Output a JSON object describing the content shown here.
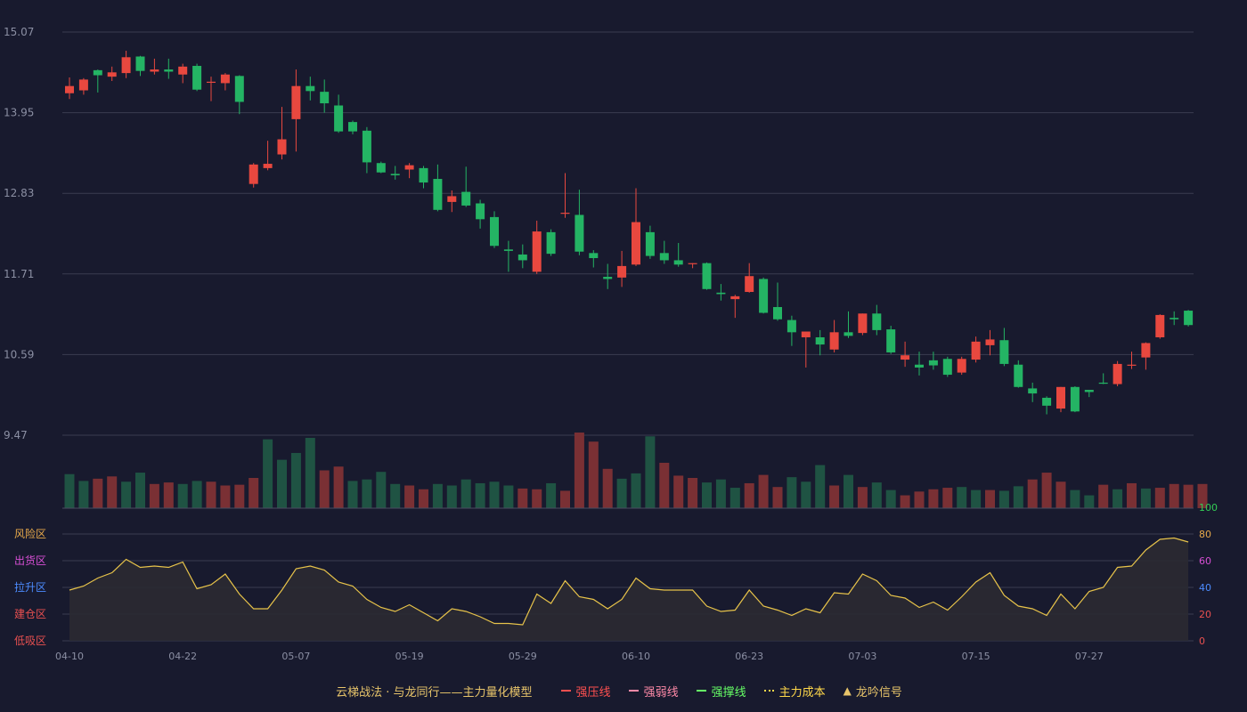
{
  "chart_data": {
    "type": "candlestick",
    "x_tick_labels": [
      "04-10",
      "04-22",
      "05-07",
      "05-19",
      "05-29",
      "06-10",
      "06-23",
      "07-03",
      "07-15",
      "07-27"
    ],
    "x_tick_index": [
      0,
      8,
      16,
      24,
      32,
      40,
      48,
      56,
      64,
      72
    ],
    "price_axis": {
      "ticks": [
        15.07,
        13.95,
        12.83,
        11.71,
        10.59,
        9.47
      ],
      "range": [
        9.47,
        15.07
      ]
    },
    "candles": [
      [
        14.22,
        14.32,
        14.14,
        14.44
      ],
      [
        14.26,
        14.41,
        14.2,
        14.43
      ],
      [
        14.54,
        14.47,
        14.23,
        14.55
      ],
      [
        14.45,
        14.51,
        14.39,
        14.59
      ],
      [
        14.5,
        14.72,
        14.43,
        14.81
      ],
      [
        14.73,
        14.53,
        14.46,
        14.74
      ],
      [
        14.52,
        14.55,
        14.48,
        14.7
      ],
      [
        14.55,
        14.52,
        14.42,
        14.7
      ],
      [
        14.48,
        14.59,
        14.36,
        14.63
      ],
      [
        14.6,
        14.27,
        14.25,
        14.63
      ],
      [
        14.37,
        14.38,
        14.11,
        14.45
      ],
      [
        14.36,
        14.48,
        14.26,
        14.5
      ],
      [
        14.46,
        14.1,
        13.93,
        14.47
      ],
      [
        12.96,
        13.23,
        12.91,
        13.25
      ],
      [
        13.18,
        13.24,
        13.15,
        13.56
      ],
      [
        13.37,
        13.58,
        13.3,
        14.03
      ],
      [
        13.86,
        14.32,
        13.41,
        14.55
      ],
      [
        14.32,
        14.25,
        14.12,
        14.45
      ],
      [
        14.24,
        14.08,
        13.95,
        14.41
      ],
      [
        14.05,
        13.69,
        13.67,
        14.2
      ],
      [
        13.82,
        13.69,
        13.65,
        13.84
      ],
      [
        13.7,
        13.26,
        13.11,
        13.75
      ],
      [
        13.25,
        13.12,
        13.11,
        13.27
      ],
      [
        13.1,
        13.08,
        13.02,
        13.21
      ],
      [
        13.16,
        13.22,
        13.04,
        13.25
      ],
      [
        13.18,
        12.98,
        12.9,
        13.21
      ],
      [
        13.03,
        12.6,
        12.58,
        13.23
      ],
      [
        12.71,
        12.79,
        12.57,
        12.87
      ],
      [
        12.85,
        12.66,
        12.64,
        13.2
      ],
      [
        12.69,
        12.47,
        12.34,
        12.74
      ],
      [
        12.5,
        12.1,
        12.07,
        12.58
      ],
      [
        12.05,
        12.03,
        11.74,
        12.17
      ],
      [
        11.98,
        11.9,
        11.79,
        12.12
      ],
      [
        11.74,
        12.3,
        11.71,
        12.45
      ],
      [
        12.29,
        11.99,
        11.96,
        12.33
      ],
      [
        12.55,
        12.56,
        12.49,
        13.11
      ],
      [
        12.53,
        12.02,
        11.97,
        12.88
      ],
      [
        12.0,
        11.93,
        11.8,
        12.04
      ],
      [
        11.67,
        11.64,
        11.5,
        11.85
      ],
      [
        11.66,
        11.82,
        11.53,
        12.03
      ],
      [
        11.84,
        12.43,
        11.82,
        12.9
      ],
      [
        12.29,
        11.96,
        11.92,
        12.38
      ],
      [
        12.0,
        11.9,
        11.85,
        12.17
      ],
      [
        11.9,
        11.84,
        11.81,
        12.14
      ],
      [
        11.86,
        11.86,
        11.79,
        11.86
      ],
      [
        11.86,
        11.5,
        11.49,
        11.87
      ],
      [
        11.45,
        11.43,
        11.34,
        11.57
      ],
      [
        11.36,
        11.4,
        11.1,
        11.42
      ],
      [
        11.46,
        11.68,
        11.45,
        11.86
      ],
      [
        11.64,
        11.17,
        11.16,
        11.66
      ],
      [
        11.25,
        11.08,
        11.06,
        11.59
      ],
      [
        11.07,
        10.9,
        10.71,
        11.13
      ],
      [
        10.83,
        10.91,
        10.41,
        10.91
      ],
      [
        10.83,
        10.73,
        10.58,
        10.93
      ],
      [
        10.66,
        10.9,
        10.62,
        11.07
      ],
      [
        10.9,
        10.85,
        10.82,
        11.19
      ],
      [
        10.89,
        11.16,
        10.86,
        11.16
      ],
      [
        11.16,
        10.93,
        10.86,
        11.28
      ],
      [
        10.94,
        10.62,
        10.6,
        10.99
      ],
      [
        10.52,
        10.58,
        10.42,
        10.77
      ],
      [
        10.45,
        10.41,
        10.3,
        10.63
      ],
      [
        10.51,
        10.44,
        10.38,
        10.63
      ],
      [
        10.53,
        10.31,
        10.28,
        10.56
      ],
      [
        10.34,
        10.53,
        10.31,
        10.56
      ],
      [
        10.52,
        10.77,
        10.48,
        10.84
      ],
      [
        10.72,
        10.8,
        10.58,
        10.93
      ],
      [
        10.79,
        10.46,
        10.43,
        10.96
      ],
      [
        10.45,
        10.14,
        10.13,
        10.51
      ],
      [
        10.12,
        10.05,
        9.93,
        10.2
      ],
      [
        9.99,
        9.88,
        9.76,
        10.01
      ],
      [
        9.84,
        10.14,
        9.79,
        10.14
      ],
      [
        10.14,
        9.8,
        9.79,
        10.15
      ],
      [
        10.1,
        10.07,
        10.0,
        10.1
      ],
      [
        10.2,
        10.19,
        10.18,
        10.33
      ],
      [
        10.18,
        10.46,
        10.15,
        10.5
      ],
      [
        10.44,
        10.45,
        10.39,
        10.63
      ],
      [
        10.55,
        10.75,
        10.38,
        10.76
      ],
      [
        10.83,
        11.14,
        10.81,
        11.15
      ],
      [
        11.1,
        11.08,
        11.0,
        11.19
      ],
      [
        11.2,
        11.0,
        10.98,
        11.21
      ]
    ],
    "volume": [
      0.45,
      0.36,
      0.39,
      0.42,
      0.35,
      0.47,
      0.32,
      0.34,
      0.32,
      0.36,
      0.35,
      0.3,
      0.31,
      0.4,
      0.91,
      0.64,
      0.73,
      0.93,
      0.5,
      0.55,
      0.36,
      0.38,
      0.48,
      0.32,
      0.3,
      0.25,
      0.32,
      0.3,
      0.38,
      0.33,
      0.35,
      0.3,
      0.26,
      0.25,
      0.33,
      0.23,
      1.0,
      0.88,
      0.52,
      0.39,
      0.46,
      0.95,
      0.6,
      0.43,
      0.4,
      0.34,
      0.38,
      0.27,
      0.33,
      0.44,
      0.28,
      0.41,
      0.35,
      0.57,
      0.3,
      0.44,
      0.28,
      0.34,
      0.24,
      0.17,
      0.22,
      0.25,
      0.27,
      0.28,
      0.24,
      0.24,
      0.23,
      0.29,
      0.38,
      0.47,
      0.35,
      0.24,
      0.17,
      0.31,
      0.25,
      0.33,
      0.26,
      0.27,
      0.32,
      0.31,
      0.32
    ],
    "volume_up": [
      false,
      false,
      true,
      true,
      false,
      false,
      true,
      true,
      false,
      false,
      true,
      true,
      true,
      true,
      false,
      false,
      false,
      false,
      true,
      true,
      false,
      false,
      false,
      false,
      true,
      true,
      false,
      false,
      false,
      false,
      false,
      false,
      true,
      true,
      false,
      true,
      true,
      true,
      true,
      false,
      false,
      false,
      true,
      true,
      true,
      false,
      false,
      false,
      true,
      true,
      true,
      false,
      false,
      false,
      true,
      false,
      true,
      false,
      false,
      true,
      true,
      true,
      true,
      false,
      false,
      true,
      false,
      false,
      true,
      true,
      true,
      false,
      false,
      true,
      false,
      true,
      false,
      true,
      true,
      true,
      true
    ],
    "volume_axis_label": "100",
    "indicator": {
      "values": [
        38,
        41,
        47,
        51,
        61,
        55,
        56,
        55,
        59,
        39,
        42,
        50,
        35,
        24,
        24,
        38,
        54,
        56,
        53,
        44,
        41,
        31,
        25,
        22,
        27,
        21,
        15,
        24,
        22,
        18,
        13,
        13,
        12,
        35,
        28,
        45,
        33,
        31,
        24,
        31,
        47,
        39,
        38,
        38,
        38,
        26,
        22,
        23,
        38,
        26,
        23,
        19,
        24,
        21,
        36,
        35,
        50,
        45,
        34,
        32,
        25,
        29,
        23,
        33,
        44,
        51,
        34,
        26,
        24,
        19,
        35,
        24,
        37,
        40,
        55,
        56,
        68,
        76,
        77,
        74
      ],
      "ylim": [
        0,
        80
      ],
      "right_ticks": [
        "100",
        "80",
        "60",
        "40",
        "20",
        "0"
      ],
      "zones": [
        "风险区",
        "出货区",
        "拉升区",
        "建仓区",
        "低吸区"
      ]
    },
    "colors": {
      "up": "#e8483f",
      "down": "#24b464",
      "vol_up": "#7a3034",
      "vol_down": "#1f5343",
      "indicator_line": "#e7c34a",
      "indicator_fill": "#2b2a32"
    }
  },
  "legend": {
    "title": "云梯战法 · 与龙同行——主力量化模型",
    "items": [
      {
        "label": "强压线",
        "color": "#ff5050",
        "style": "solid"
      },
      {
        "label": "强弱线",
        "color": "#ff8aa8",
        "style": "dashed"
      },
      {
        "label": "强撑线",
        "color": "#66ff66",
        "style": "solid"
      },
      {
        "label": "主力成本",
        "color": "#ffd84a",
        "style": "dotted"
      },
      {
        "label": "龙吟信号",
        "color": "#e7c46a",
        "style": "triangle"
      }
    ]
  }
}
